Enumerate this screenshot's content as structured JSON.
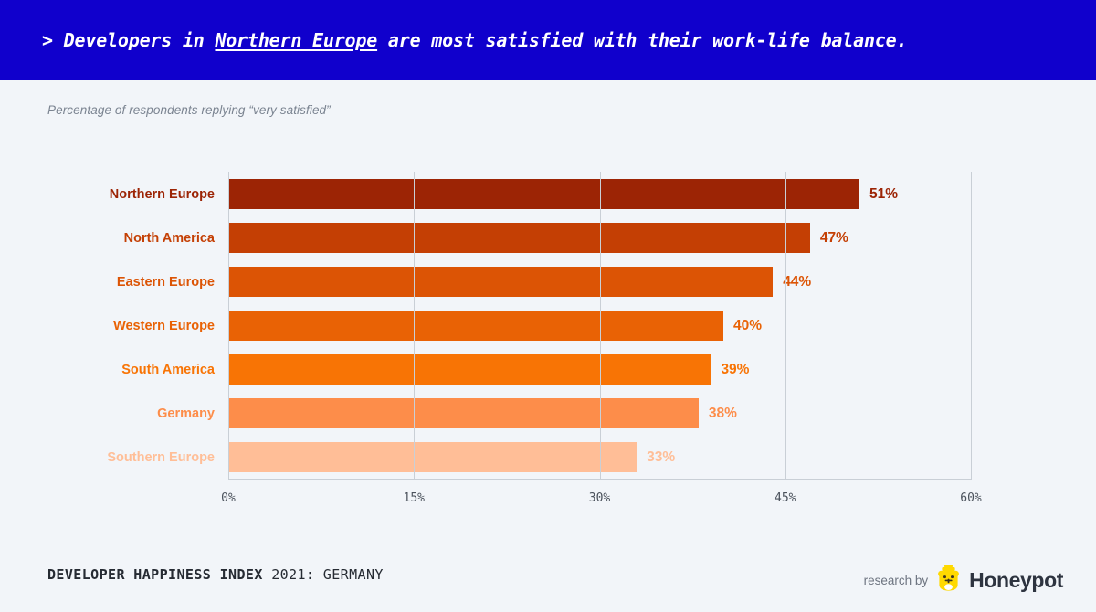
{
  "header": {
    "prefix": "> ",
    "text_before": "Developers in ",
    "highlight": "Northern Europe",
    "text_after": " are most satisfied with their work-life balance.",
    "background_color": "#1000cc",
    "text_color": "#ffffff"
  },
  "subtitle": "Percentage of respondents replying “very satisfied”",
  "footer": {
    "title_strong": "DEVELOPER HAPPINESS INDEX",
    "title_light": " 2021: GERMANY",
    "research_by": "research by",
    "brand": "Honeypot",
    "brand_color": "#2e3440",
    "mascot_color": "#ffd900"
  },
  "chart_data": {
    "type": "bar",
    "orientation": "horizontal",
    "title": "Developers in Northern Europe are most satisfied with their work-life balance.",
    "subtitle": "Percentage of respondents replying “very satisfied”",
    "xlabel": "",
    "ylabel": "",
    "xlim": [
      0,
      60
    ],
    "grid": true,
    "legend": "none",
    "categories": [
      "Northern Europe",
      "North America",
      "Eastern Europe",
      "Western Europe",
      "South America",
      "Germany",
      "Southern Europe"
    ],
    "values": [
      51,
      47,
      44,
      40,
      39,
      38,
      33
    ],
    "value_labels": [
      "51%",
      "47%",
      "44%",
      "40%",
      "39%",
      "38%",
      "33%"
    ],
    "colors": [
      "#9c2405",
      "#c43f04",
      "#dc5405",
      "#e96205",
      "#f87405",
      "#fd8d4a",
      "#ffbe97"
    ],
    "xticks": [
      0,
      15,
      30,
      45,
      60
    ],
    "xtick_labels": [
      "0%",
      "15%",
      "30%",
      "45%",
      "60%"
    ]
  }
}
